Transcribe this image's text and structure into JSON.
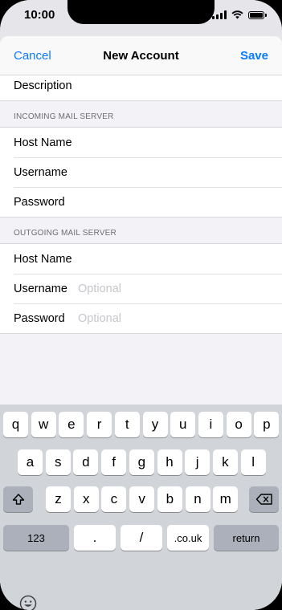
{
  "status_bar": {
    "time": "10:00"
  },
  "nav": {
    "cancel": "Cancel",
    "title": "New Account",
    "save": "Save"
  },
  "form": {
    "description_label": "Description",
    "incoming": {
      "header": "INCOMING MAIL SERVER",
      "host_label": "Host Name",
      "username_label": "Username",
      "password_label": "Password"
    },
    "outgoing": {
      "header": "OUTGOING MAIL SERVER",
      "host_label": "Host Name",
      "username_label": "Username",
      "username_placeholder": "Optional",
      "password_label": "Password",
      "password_placeholder": "Optional"
    }
  },
  "keyboard": {
    "row1": [
      "q",
      "w",
      "e",
      "r",
      "t",
      "y",
      "u",
      "i",
      "o",
      "p"
    ],
    "row2": [
      "a",
      "s",
      "d",
      "f",
      "g",
      "h",
      "j",
      "k",
      "l"
    ],
    "row3": [
      "z",
      "x",
      "c",
      "v",
      "b",
      "n",
      "m"
    ],
    "numbers_key": "123",
    "dot_key": ".",
    "slash_key": "/",
    "domain_key": ".co.uk",
    "return_key": "return"
  },
  "icons": {
    "shift": "shift-icon",
    "delete": "delete-icon",
    "emoji": "emoji-icon",
    "signal": "signal-icon",
    "wifi": "wifi-icon",
    "battery": "battery-icon"
  },
  "colors": {
    "accent": "#0a7aff",
    "keyboard_bg": "#d1d4d9",
    "dark_key": "#abb0ba"
  }
}
